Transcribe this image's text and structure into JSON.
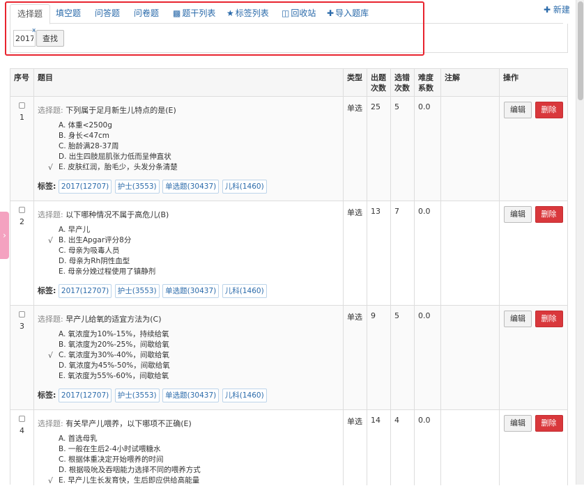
{
  "tabs": [
    {
      "label": "选择题",
      "icon": "",
      "active": true
    },
    {
      "label": "填空题",
      "icon": ""
    },
    {
      "label": "问答题",
      "icon": ""
    },
    {
      "label": "问卷题",
      "icon": ""
    },
    {
      "label": "题干列表",
      "icon": "book-icon"
    },
    {
      "label": "标签列表",
      "icon": "star-icon"
    },
    {
      "label": "回收站",
      "icon": "trash-icon"
    },
    {
      "label": "导入题库",
      "icon": "plus-icon"
    }
  ],
  "new_label": "新建",
  "filter": {
    "year_value": "2017",
    "clear_label": "x",
    "search_label": "查找"
  },
  "columns": {
    "no": "序号",
    "question": "题目",
    "type": "类型",
    "times": "出题次数",
    "wrong": "选错次数",
    "difficulty": "难度系数",
    "note": "注解",
    "ops": "操作"
  },
  "tags_label": "标签:",
  "edit_label": "编辑",
  "delete_label": "删除",
  "colors": {
    "link": "#2a6aaa",
    "delete": "#d9383c",
    "highlight": "#e8232e",
    "side_tab": "#f4a2c0"
  },
  "questions": [
    {
      "no": "1",
      "prefix": "选择题:",
      "text": "下列属于足月新生儿特点的是(E)",
      "type": "单选",
      "times": "25",
      "wrong": "5",
      "difficulty": "0.0",
      "options": [
        {
          "text": "A. 体重<2500g",
          "correct": false
        },
        {
          "text": "B. 身长<47cm",
          "correct": false
        },
        {
          "text": "C. 胎龄满28-37周",
          "correct": false
        },
        {
          "text": "D. 出生四肢屈肌张力低而呈伸直状",
          "correct": false
        },
        {
          "text": "E. 皮肤红润，胎毛少，头发分条清楚",
          "correct": true
        }
      ],
      "tags": [
        "2017(12707)",
        "护士(3553)",
        "单选题(30437)",
        "儿科(1460)"
      ]
    },
    {
      "no": "2",
      "prefix": "选择题:",
      "text": "以下哪种情况不属于高危儿(B)",
      "type": "单选",
      "times": "13",
      "wrong": "7",
      "difficulty": "0.0",
      "options": [
        {
          "text": "A. 早产儿",
          "correct": false
        },
        {
          "text": "B. 出生Apgar评分8分",
          "correct": true
        },
        {
          "text": "C. 母亲为吸毒人员",
          "correct": false
        },
        {
          "text": "D. 母亲为Rh阴性血型",
          "correct": false
        },
        {
          "text": "E. 母亲分娩过程使用了镇静剂",
          "correct": false
        }
      ],
      "tags": [
        "2017(12707)",
        "护士(3553)",
        "单选题(30437)",
        "儿科(1460)"
      ]
    },
    {
      "no": "3",
      "prefix": "选择题:",
      "text": "早产儿给氧的适宜方法为(C)",
      "type": "单选",
      "times": "9",
      "wrong": "5",
      "difficulty": "0.0",
      "options": [
        {
          "text": "A. 氧浓度为10%-15%，持续给氧",
          "correct": false
        },
        {
          "text": "B. 氧浓度为20%-25%，间歇给氧",
          "correct": false
        },
        {
          "text": "C. 氧浓度为30%-40%，间歇给氧",
          "correct": true
        },
        {
          "text": "D. 氧浓度为45%-50%，间歇给氧",
          "correct": false
        },
        {
          "text": "E. 氧浓度为55%-60%，间歇给氧",
          "correct": false
        }
      ],
      "tags": [
        "2017(12707)",
        "护士(3553)",
        "单选题(30437)",
        "儿科(1460)"
      ]
    },
    {
      "no": "4",
      "prefix": "选择题:",
      "text": "有关早产儿喂养，以下哪项不正确(E)",
      "type": "单选",
      "times": "14",
      "wrong": "4",
      "difficulty": "0.0",
      "options": [
        {
          "text": "A. 首选母乳",
          "correct": false
        },
        {
          "text": "B. 一般在生后2-4小时试喂糖水",
          "correct": false
        },
        {
          "text": "C. 根据体重决定开始喂养的时间",
          "correct": false
        },
        {
          "text": "D. 根据吸吮及吞咽能力选择不同的喂养方式",
          "correct": false
        },
        {
          "text": "E. 早产儿生长发育快，生后即应供给高能量",
          "correct": true
        }
      ],
      "tags": []
    }
  ]
}
